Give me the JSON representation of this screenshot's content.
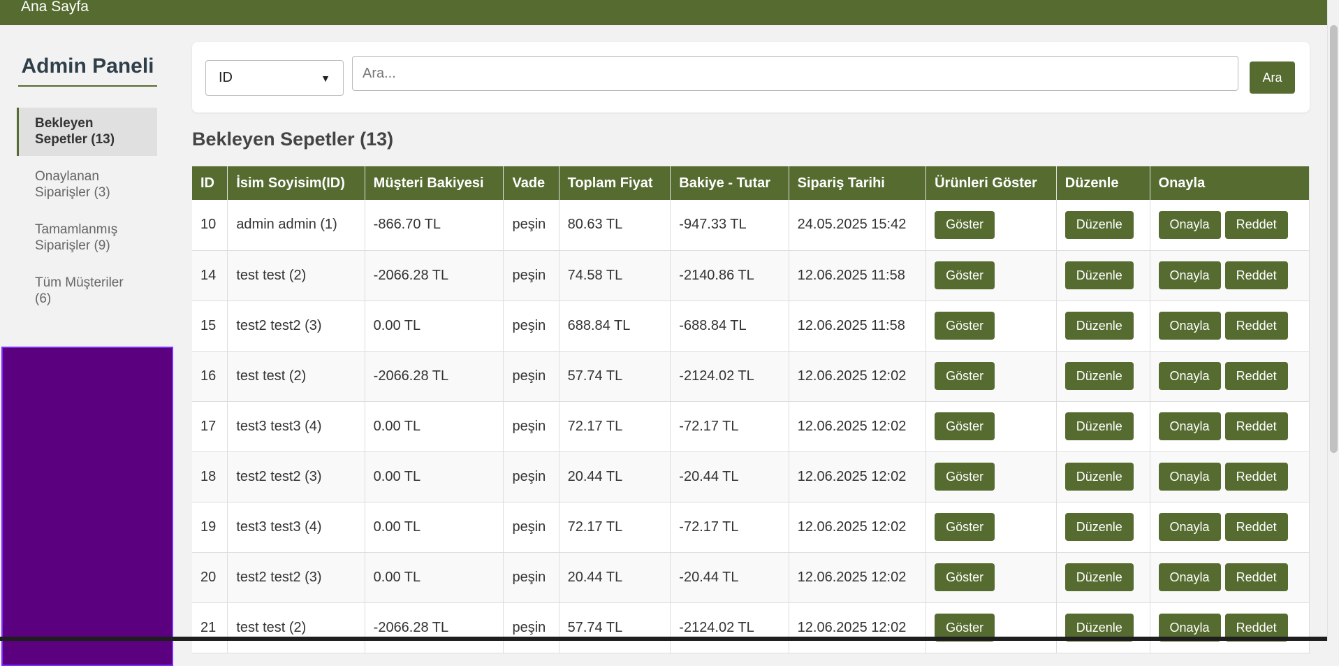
{
  "topbar": {
    "home_link": "Ana Sayfa"
  },
  "sidebar": {
    "title": "Admin Paneli",
    "items": [
      {
        "label": "Bekleyen Sepetler (13)",
        "active": true
      },
      {
        "label": "Onaylanan Siparişler (3)",
        "active": false
      },
      {
        "label": "Tamamlanmış Siparişler (9)",
        "active": false
      },
      {
        "label": "Tüm Müşteriler (6)",
        "active": false
      }
    ]
  },
  "search": {
    "selected_field": "ID",
    "placeholder": "Ara...",
    "button_label": "Ara"
  },
  "section_title": "Bekleyen Sepetler (13)",
  "table": {
    "headers": [
      "ID",
      "İsim Soyisim(ID)",
      "Müşteri Bakiyesi",
      "Vade",
      "Toplam Fiyat",
      "Bakiye - Tutar",
      "Sipariş Tarihi",
      "Ürünleri Göster",
      "Düzenle",
      "Onayla"
    ],
    "button_labels": {
      "show": "Göster",
      "edit": "Düzenle",
      "approve": "Onayla",
      "reject": "Reddet"
    },
    "rows": [
      {
        "id": "10",
        "name": "admin admin (1)",
        "balance": "-866.70 TL",
        "term": "peşin",
        "total": "80.63 TL",
        "diff": "-947.33 TL",
        "date": "24.05.2025 15:42"
      },
      {
        "id": "14",
        "name": "test test (2)",
        "balance": "-2066.28 TL",
        "term": "peşin",
        "total": "74.58 TL",
        "diff": "-2140.86 TL",
        "date": "12.06.2025 11:58"
      },
      {
        "id": "15",
        "name": "test2 test2 (3)",
        "balance": "0.00 TL",
        "term": "peşin",
        "total": "688.84 TL",
        "diff": "-688.84 TL",
        "date": "12.06.2025 11:58"
      },
      {
        "id": "16",
        "name": "test test (2)",
        "balance": "-2066.28 TL",
        "term": "peşin",
        "total": "57.74 TL",
        "diff": "-2124.02 TL",
        "date": "12.06.2025 12:02"
      },
      {
        "id": "17",
        "name": "test3 test3 (4)",
        "balance": "0.00 TL",
        "term": "peşin",
        "total": "72.17 TL",
        "diff": "-72.17 TL",
        "date": "12.06.2025 12:02"
      },
      {
        "id": "18",
        "name": "test2 test2 (3)",
        "balance": "0.00 TL",
        "term": "peşin",
        "total": "20.44 TL",
        "diff": "-20.44 TL",
        "date": "12.06.2025 12:02"
      },
      {
        "id": "19",
        "name": "test3 test3 (4)",
        "balance": "0.00 TL",
        "term": "peşin",
        "total": "72.17 TL",
        "diff": "-72.17 TL",
        "date": "12.06.2025 12:02"
      },
      {
        "id": "20",
        "name": "test2 test2 (3)",
        "balance": "0.00 TL",
        "term": "peşin",
        "total": "20.44 TL",
        "diff": "-20.44 TL",
        "date": "12.06.2025 12:02"
      },
      {
        "id": "21",
        "name": "test test (2)",
        "balance": "-2066.28 TL",
        "term": "peşin",
        "total": "57.74 TL",
        "diff": "-2124.02 TL",
        "date": "12.06.2025 12:02"
      }
    ]
  },
  "colors": {
    "accent": "#556b2f",
    "sidebar_block": "#5b007f"
  },
  "icons": {
    "select_caret": "chevron-down-icon"
  }
}
